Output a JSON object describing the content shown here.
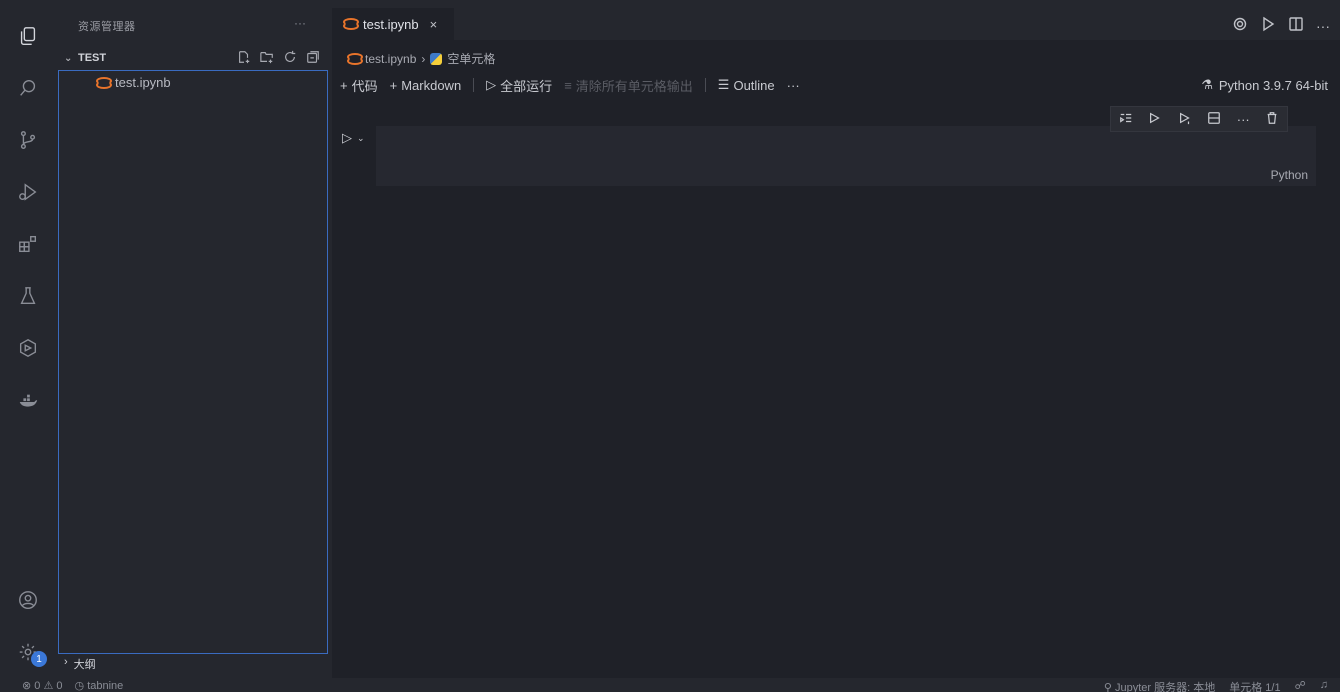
{
  "sidebar": {
    "title": "资源管理器",
    "more": "···",
    "section_label": "TEST",
    "file_name": "test.ipynb",
    "outline_label": "大纲"
  },
  "tabbar": {
    "tab_label": "test.ipynb",
    "tab_close": "×",
    "more": "···"
  },
  "breadcrumb": {
    "file": "test.ipynb",
    "separator": "›",
    "cell": "空单元格"
  },
  "toolbar": {
    "add_code": "代码",
    "add_markdown": "Markdown",
    "run_all": "全部运行",
    "clear_outputs": "清除所有单元格输出",
    "outline": "Outline",
    "more": "···"
  },
  "kernel": {
    "label": "Python 3.9.7 64-bit"
  },
  "cell": {
    "language": "Python",
    "toolbar_more": "···"
  },
  "activity": {
    "badge": "1"
  },
  "status": {
    "errors": "0",
    "warnings": "0",
    "tabnine": "tabnine",
    "jupyter_server": "Jupyter 服务器: 本地",
    "cell_position": "单元格 1/1"
  }
}
